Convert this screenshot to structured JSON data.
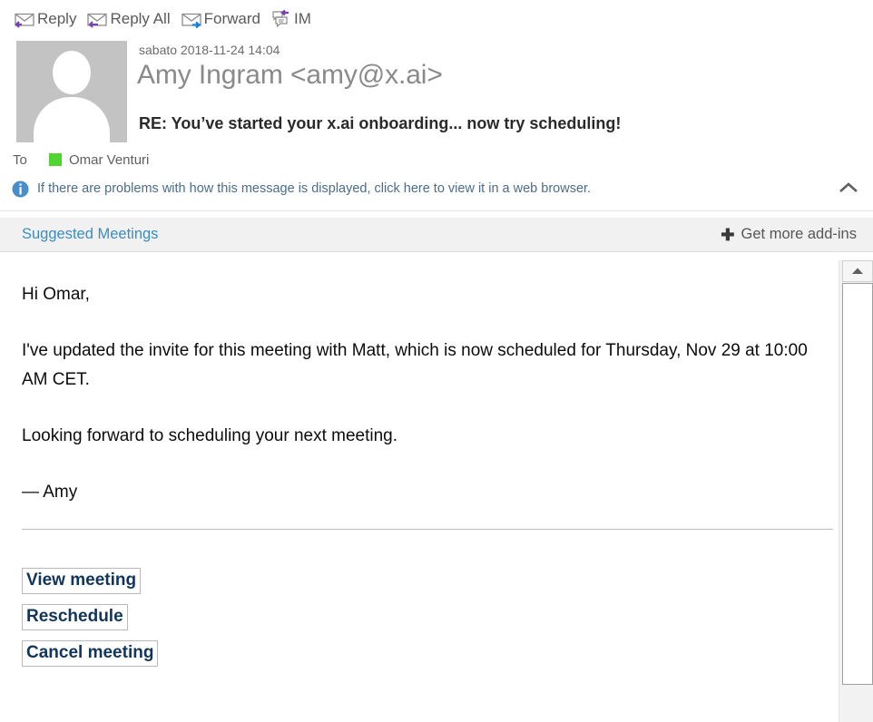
{
  "toolbar": {
    "buttons": [
      {
        "label": "Reply",
        "icon": "reply-envelope-icon"
      },
      {
        "label": "Reply All",
        "icon": "reply-all-envelope-icon"
      },
      {
        "label": "Forward",
        "icon": "forward-envelope-icon"
      },
      {
        "label": "IM",
        "icon": "instant-message-icon"
      }
    ]
  },
  "header": {
    "date": "sabato 2018-11-24 14:04",
    "from": "Amy Ingram <amy@x.ai>",
    "subject": "RE: You’ve started your x.ai onboarding... now try scheduling!",
    "avatar_icon": "person-placeholder-avatar"
  },
  "recipients": {
    "to_label": "To",
    "to_name": "Omar Venturi",
    "presence_color": "#4fd432"
  },
  "info_bar": {
    "icon": "info-circle-icon",
    "text": "If there are problems with how this message is displayed, click here to view it in a web browser.",
    "collapse_icon": "chevron-up-icon",
    "text_color": "#4a6d8c"
  },
  "addins_bar": {
    "suggested_meetings_label": "Suggested Meetings",
    "get_more_label": "Get more add-ins",
    "plus_icon": "plus-icon",
    "link_color": "#3a8dc4"
  },
  "message_body": {
    "greeting": "Hi Omar,",
    "paragraph_1": "I've updated the invite for this meeting with Matt, which is now scheduled for Thursday, Nov 29 at 10:00 AM CET.",
    "paragraph_2": "Looking forward to scheduling your next meeting.",
    "signature": "— Amy",
    "action_links": [
      "View meeting",
      "Reschedule",
      "Cancel meeting"
    ],
    "link_color": "#12355b"
  },
  "scrollbar": {
    "up_arrow_icon": "scroll-up-arrow-icon"
  }
}
